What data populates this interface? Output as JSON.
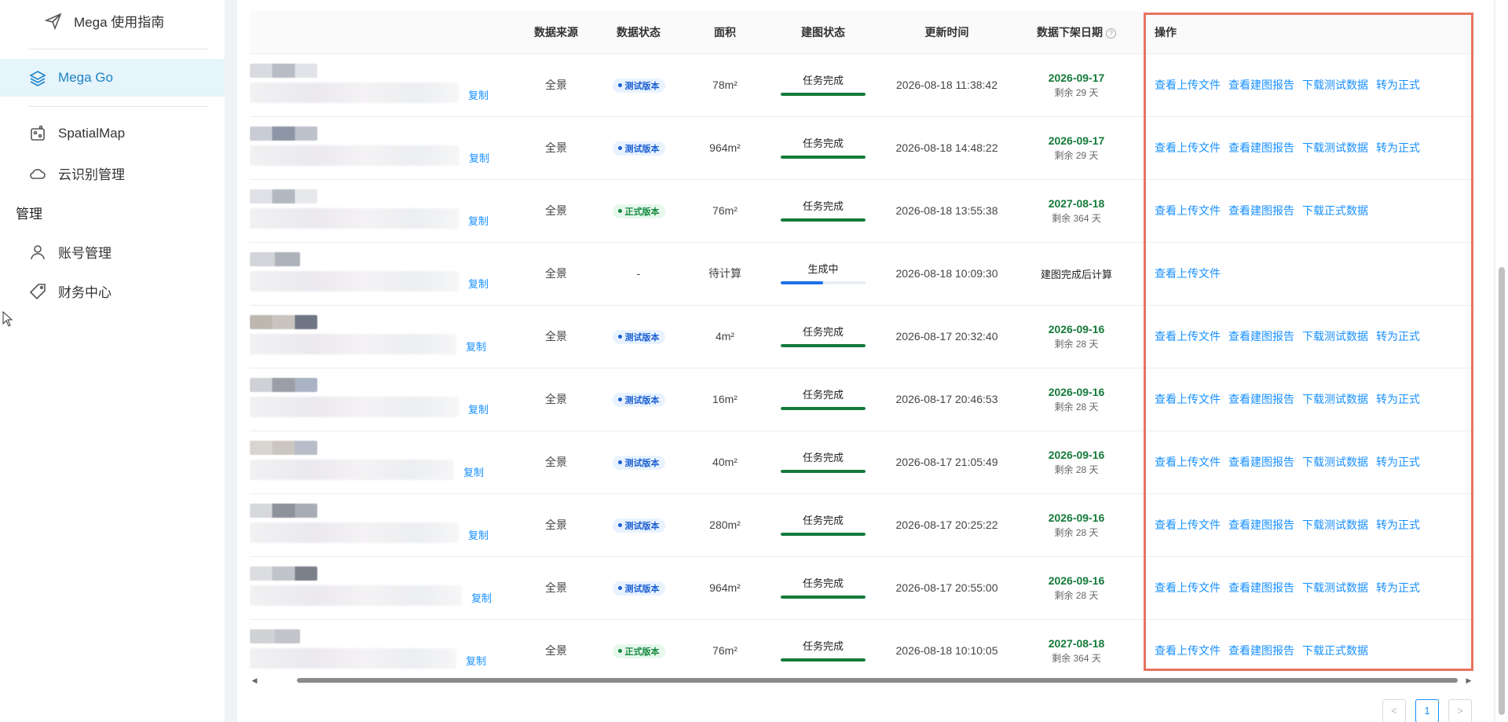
{
  "sidebar": {
    "guide": "Mega 使用指南",
    "mega_go": "Mega Go",
    "spatialmap": "SpatialMap",
    "cloud_recog": "云识别管理",
    "group_manage": "管理",
    "account": "账号管理",
    "finance": "财务中心"
  },
  "table": {
    "headers": {
      "source": "数据来源",
      "status": "数据状态",
      "area": "面积",
      "build": "建图状态",
      "updated": "更新时间",
      "expire": "数据下架日期",
      "ops": "操作"
    },
    "help_glyph": "?",
    "copy_label": "复制",
    "rows": [
      {
        "source": "全景",
        "tag": "测试版本",
        "tag_type": "test",
        "area": "78m²",
        "build": "任务完成",
        "progress": 1.0,
        "updated": "2026-08-18 11:38:42",
        "expire_date": "2026-09-17",
        "expire_left": "剩余 29 天",
        "expire_text": "",
        "ops": [
          "查看上传文件",
          "查看建图报告",
          "下载测试数据",
          "转为正式"
        ]
      },
      {
        "source": "全景",
        "tag": "测试版本",
        "tag_type": "test",
        "area": "964m²",
        "build": "任务完成",
        "progress": 1.0,
        "updated": "2026-08-18 14:48:22",
        "expire_date": "2026-09-17",
        "expire_left": "剩余 29 天",
        "expire_text": "",
        "ops": [
          "查看上传文件",
          "查看建图报告",
          "下载测试数据",
          "转为正式"
        ]
      },
      {
        "source": "全景",
        "tag": "正式版本",
        "tag_type": "prod",
        "area": "76m²",
        "build": "任务完成",
        "progress": 1.0,
        "updated": "2026-08-18 13:55:38",
        "expire_date": "2027-08-18",
        "expire_left": "剩余 364 天",
        "expire_text": "",
        "ops": [
          "查看上传文件",
          "查看建图报告",
          "下载正式数据"
        ]
      },
      {
        "source": "全景",
        "tag": "-",
        "tag_type": "none",
        "area": "待计算",
        "build": "生成中",
        "progress": 0.5,
        "updated": "2026-08-18 10:09:30",
        "expire_date": "",
        "expire_left": "",
        "expire_text": "建图完成后计算",
        "ops": [
          "查看上传文件"
        ]
      },
      {
        "source": "全景",
        "tag": "测试版本",
        "tag_type": "test",
        "area": "4m²",
        "build": "任务完成",
        "progress": 1.0,
        "updated": "2026-08-17 20:32:40",
        "expire_date": "2026-09-16",
        "expire_left": "剩余 28 天",
        "expire_text": "",
        "ops": [
          "查看上传文件",
          "查看建图报告",
          "下载测试数据",
          "转为正式"
        ]
      },
      {
        "source": "全景",
        "tag": "测试版本",
        "tag_type": "test",
        "area": "16m²",
        "build": "任务完成",
        "progress": 1.0,
        "updated": "2026-08-17 20:46:53",
        "expire_date": "2026-09-16",
        "expire_left": "剩余 28 天",
        "expire_text": "",
        "ops": [
          "查看上传文件",
          "查看建图报告",
          "下载测试数据",
          "转为正式"
        ]
      },
      {
        "source": "全景",
        "tag": "测试版本",
        "tag_type": "test",
        "area": "40m²",
        "build": "任务完成",
        "progress": 1.0,
        "updated": "2026-08-17 21:05:49",
        "expire_date": "2026-09-16",
        "expire_left": "剩余 28 天",
        "expire_text": "",
        "ops": [
          "查看上传文件",
          "查看建图报告",
          "下载测试数据",
          "转为正式"
        ]
      },
      {
        "source": "全景",
        "tag": "测试版本",
        "tag_type": "test",
        "area": "280m²",
        "build": "任务完成",
        "progress": 1.0,
        "updated": "2026-08-17 20:25:22",
        "expire_date": "2026-09-16",
        "expire_left": "剩余 28 天",
        "expire_text": "",
        "ops": [
          "查看上传文件",
          "查看建图报告",
          "下载测试数据",
          "转为正式"
        ]
      },
      {
        "source": "全景",
        "tag": "测试版本",
        "tag_type": "test",
        "area": "964m²",
        "build": "任务完成",
        "progress": 1.0,
        "updated": "2026-08-17 20:55:00",
        "expire_date": "2026-09-16",
        "expire_left": "剩余 28 天",
        "expire_text": "",
        "ops": [
          "查看上传文件",
          "查看建图报告",
          "下载测试数据",
          "转为正式"
        ]
      },
      {
        "source": "全景",
        "tag": "正式版本",
        "tag_type": "prod",
        "area": "76m²",
        "build": "任务完成",
        "progress": 1.0,
        "updated": "2026-08-18 10:10:05",
        "expire_date": "2027-08-18",
        "expire_left": "剩余 364 天",
        "expire_text": "",
        "ops": [
          "查看上传文件",
          "查看建图报告",
          "下载正式数据"
        ]
      }
    ]
  },
  "pagination": {
    "prev": "<",
    "current": "1",
    "next": ">"
  },
  "colors": {
    "accent": "#1890ff",
    "success": "#157a3a",
    "highlight": "#e8735f",
    "progress_running": "#1e6fe8"
  }
}
